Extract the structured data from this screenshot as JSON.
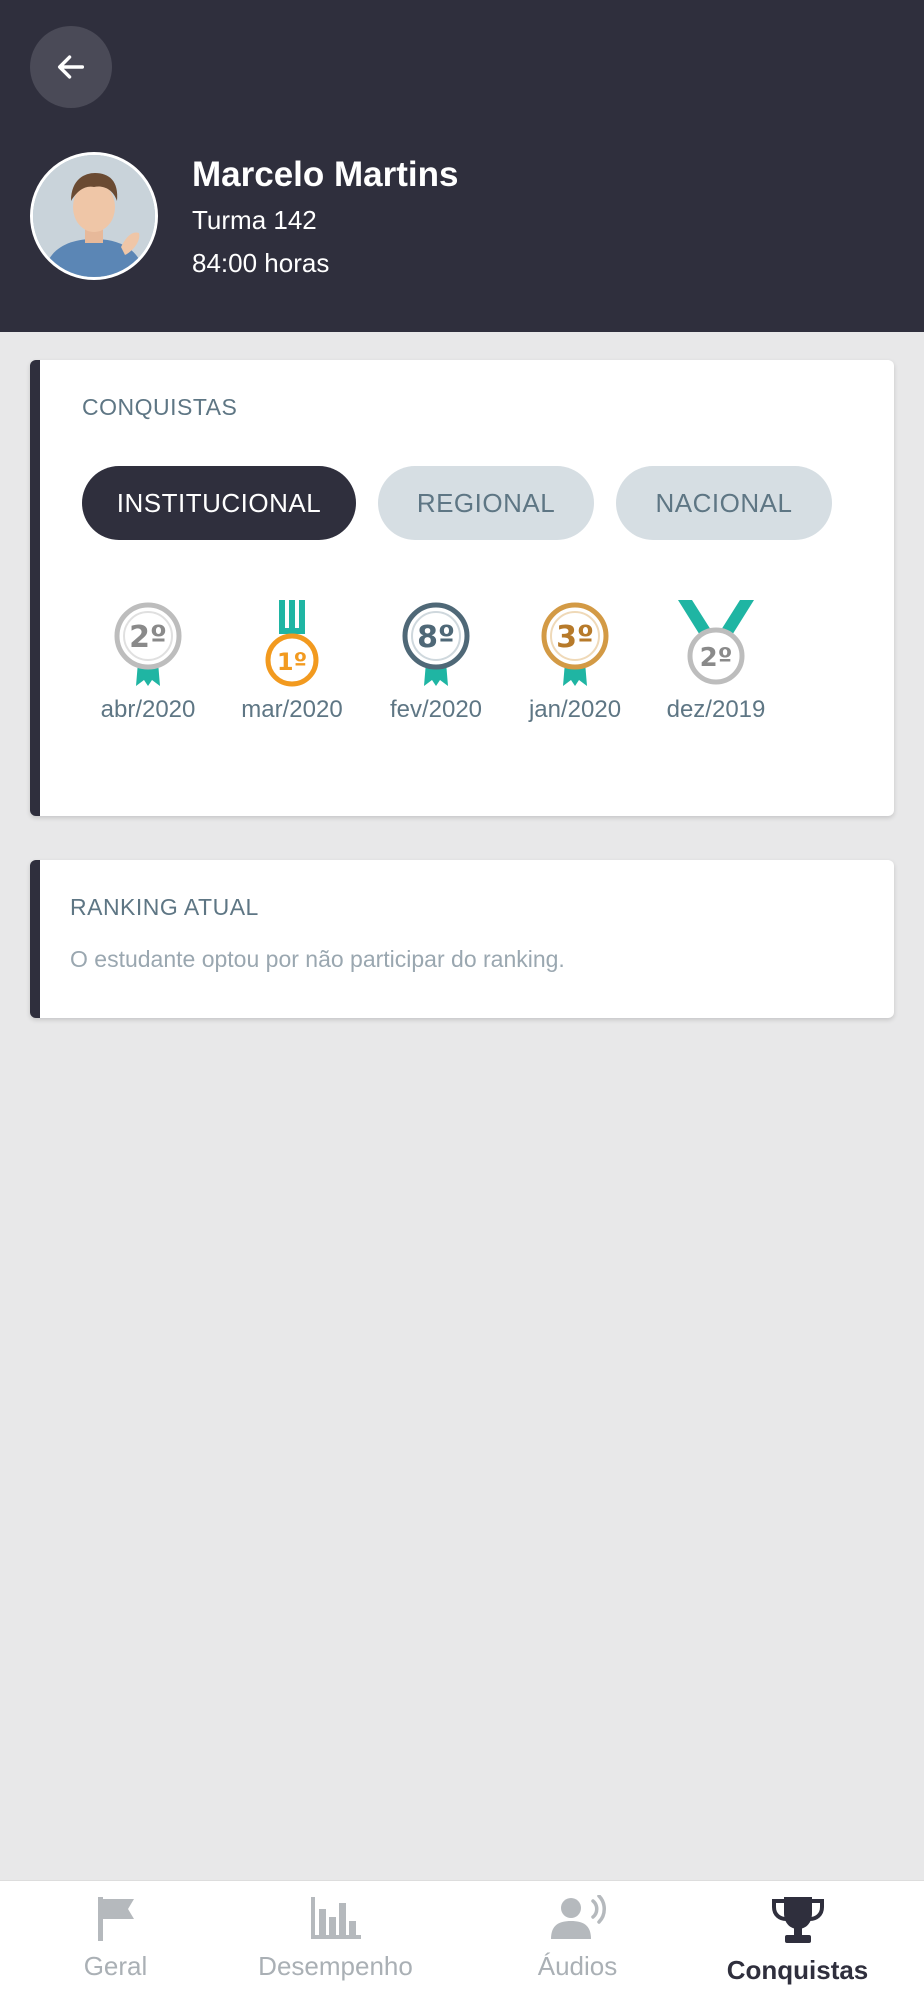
{
  "header": {
    "name": "Marcelo Martins",
    "class": "Turma 142",
    "hours": "84:00 horas"
  },
  "achievements": {
    "title": "CONQUISTAS",
    "tabs": [
      {
        "label": "INSTITUCIONAL",
        "active": true
      },
      {
        "label": "REGIONAL",
        "active": false
      },
      {
        "label": "NACIONAL",
        "active": false
      }
    ],
    "medals": [
      {
        "place": "2º",
        "date": "abr/2020",
        "color": "#8a8a8a",
        "ribbon": "#1fb5a3"
      },
      {
        "place": "1º",
        "date": "mar/2020",
        "color": "#f29a1f",
        "ribbon": "#1fb5a3"
      },
      {
        "place": "8º",
        "date": "fev/2020",
        "color": "#4f6877",
        "ribbon": "#1fb5a3"
      },
      {
        "place": "3º",
        "date": "jan/2020",
        "color": "#b77a2a",
        "ribbon": "#1fb5a3"
      },
      {
        "place": "2º",
        "date": "dez/2019",
        "color": "#8a8a8a",
        "ribbon": "#1fb5a3"
      }
    ]
  },
  "ranking": {
    "title": "RANKING ATUAL",
    "message": "O estudante optou por não participar do ranking."
  },
  "nav": {
    "items": [
      {
        "label": "Geral",
        "icon": "flag-icon",
        "active": false
      },
      {
        "label": "Desempenho",
        "icon": "bar-chart-icon",
        "active": false
      },
      {
        "label": "Áudios",
        "icon": "speaker-person-icon",
        "active": false
      },
      {
        "label": "Conquistas",
        "icon": "trophy-icon",
        "active": true
      }
    ]
  },
  "colors": {
    "header_bg": "#2f2f3d",
    "page_bg": "#e8e8e9",
    "accent_teal": "#1fb5a3",
    "muted_text": "#5e7684"
  }
}
